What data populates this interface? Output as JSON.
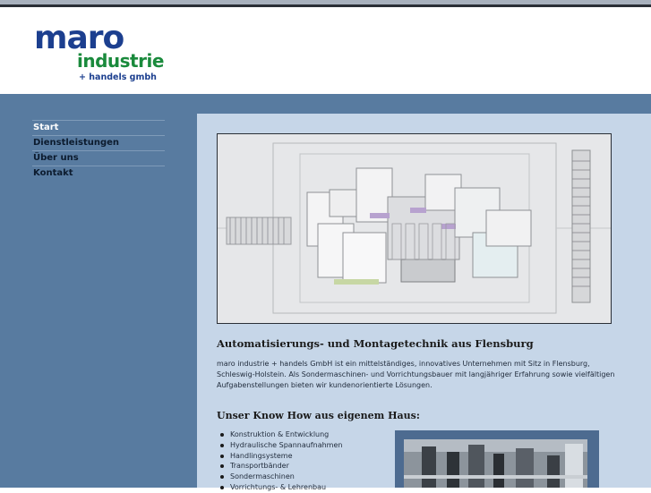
{
  "logo": {
    "line1": "maro",
    "line2": "industrie",
    "line3": "+ handels gmbh"
  },
  "nav": {
    "items": [
      "Start",
      "Dienstleistungen",
      "Über uns",
      "Kontakt"
    ],
    "active": "Start"
  },
  "main": {
    "heading": "Automatisierungs- und Montagetechnik aus Flensburg",
    "intro": "maro industrie + handels GmbH ist ein mittelständiges, innovatives Unternehmen mit Sitz in Flensburg, Schleswig-Holstein. Als Sondermaschinen- und Vorrichtungsbauer mit langjähriger Erfahrung sowie vielfältigen Aufgabenstellungen bieten wir kundenorientierte Lösungen.",
    "subheading": "Unser Know How aus eigenem Haus:",
    "services": [
      "Konstruktion & Entwicklung",
      "Hydraulische Spannaufnahmen",
      "Handlingsysteme",
      "Transportbänder",
      "Sondermaschinen",
      "Vorrichtungs- & Lehrenbau"
    ]
  },
  "colors": {
    "sidebar": "#587ba0",
    "content": "#c6d6e8",
    "logo_blue": "#1c3f8f",
    "logo_green": "#1a8a3c"
  }
}
